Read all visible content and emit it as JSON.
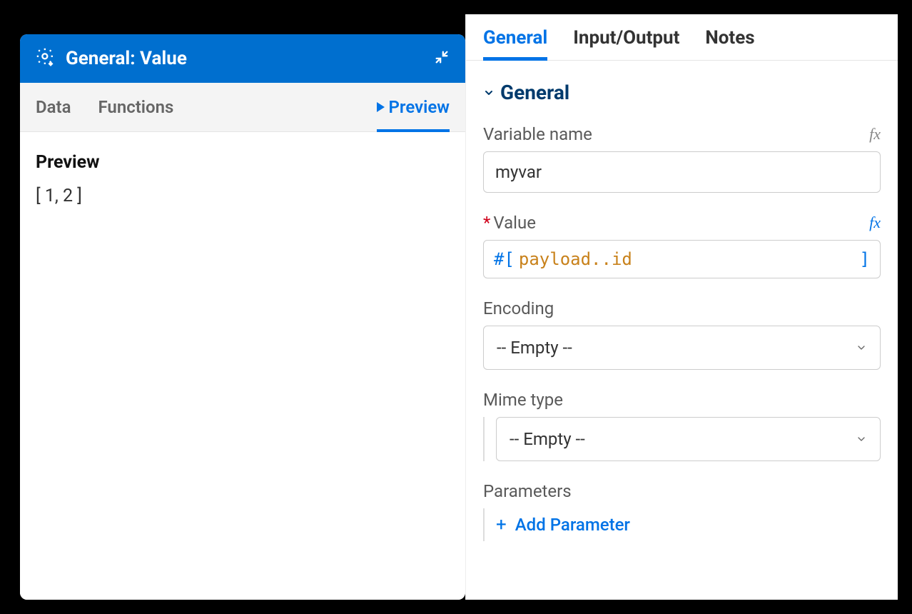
{
  "leftPanel": {
    "headerTitle": "General: Value",
    "tabs": {
      "data": "Data",
      "functions": "Functions",
      "preview": "Preview"
    },
    "previewHeading": "Preview",
    "previewValue": "[ 1, 2 ]"
  },
  "rightPanel": {
    "tabs": {
      "general": "General",
      "inputOutput": "Input/Output",
      "notes": "Notes"
    },
    "sectionTitle": "General",
    "fields": {
      "variableName": {
        "label": "Variable name",
        "value": "myvar"
      },
      "value": {
        "label": "Value",
        "openBracket": "#[",
        "body": "payload..id",
        "closeBracket": "]"
      },
      "encoding": {
        "label": "Encoding",
        "selected": "-- Empty --"
      },
      "mimeType": {
        "label": "Mime type",
        "selected": "-- Empty --"
      },
      "parameters": {
        "label": "Parameters",
        "addLabel": "Add Parameter"
      }
    }
  }
}
